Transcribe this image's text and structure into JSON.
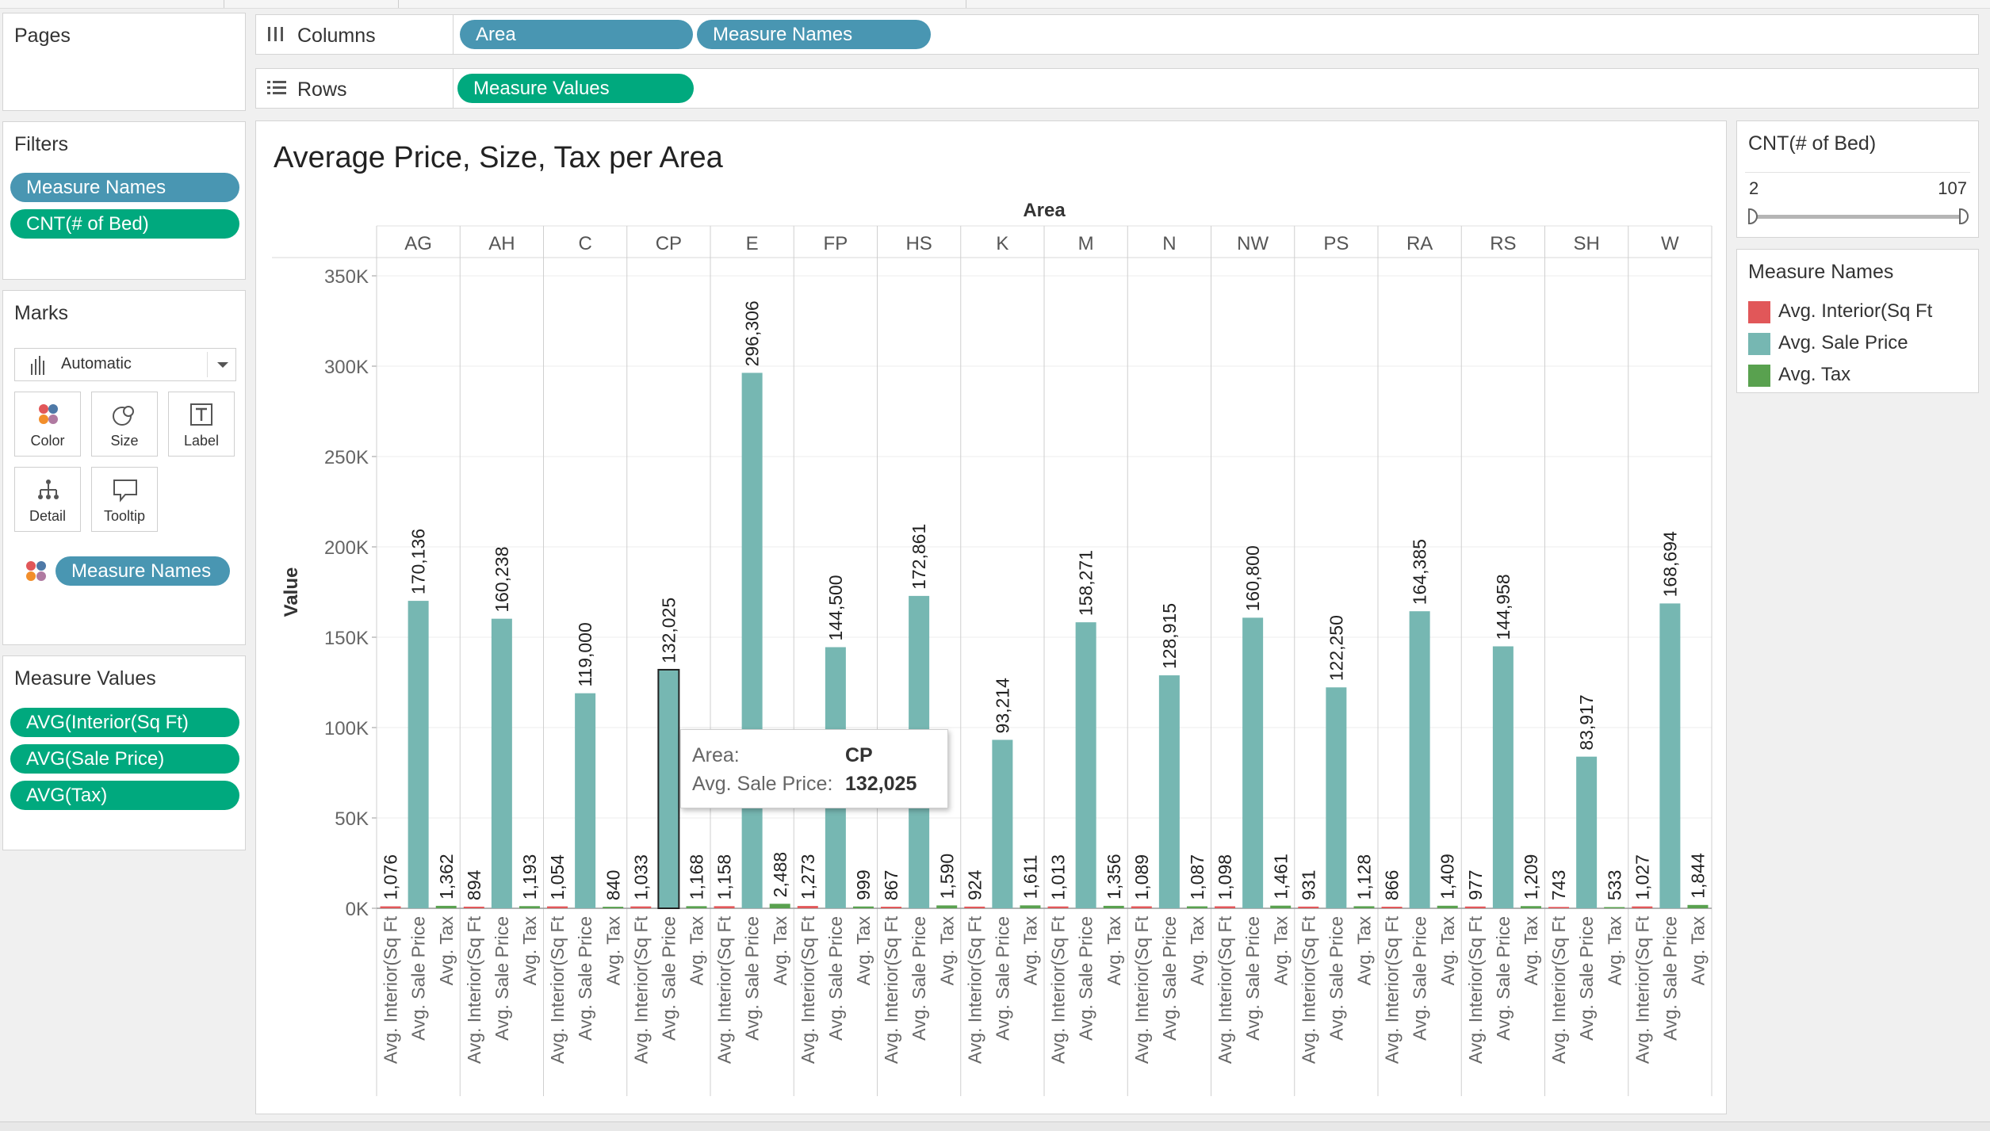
{
  "top_tabs": [],
  "pages_panel": {
    "title": "Pages"
  },
  "filters_panel": {
    "title": "Filters",
    "pills": [
      "Measure Names",
      "CNT(# of Bed)"
    ]
  },
  "marks_panel": {
    "title": "Marks",
    "mark_type": "Automatic",
    "cards": [
      {
        "label": "Color",
        "icon": "color-icon"
      },
      {
        "label": "Size",
        "icon": "size-icon"
      },
      {
        "label": "Label",
        "icon": "label-icon"
      },
      {
        "label": "Detail",
        "icon": "detail-icon"
      },
      {
        "label": "Tooltip",
        "icon": "tooltip-icon"
      }
    ],
    "color_pill": "Measure Names"
  },
  "measure_values_panel": {
    "title": "Measure Values",
    "pills": [
      "AVG(Interior(Sq Ft)",
      "AVG(Sale Price)",
      "AVG(Tax)"
    ]
  },
  "shelves": {
    "columns": {
      "title": "Columns",
      "pills": [
        "Area",
        "Measure Names"
      ]
    },
    "rows": {
      "title": "Rows",
      "pills": [
        "Measure Values"
      ]
    }
  },
  "cnt_filter": {
    "title": "CNT(# of Bed)",
    "min": "2",
    "max": "107"
  },
  "legend": {
    "title": "Measure Names",
    "items": [
      {
        "label": "Avg. Interior(Sq Ft",
        "color": "#e15759"
      },
      {
        "label": "Avg. Sale Price",
        "color": "#76b7b2"
      },
      {
        "label": "Avg. Tax",
        "color": "#59a14f"
      }
    ]
  },
  "tooltip": {
    "area_label": "Area:",
    "area_value": "CP",
    "price_label": "Avg. Sale Price:",
    "price_value": "132,025"
  },
  "chart_data": {
    "type": "bar",
    "title": "Average Price, Size, Tax per Area",
    "column_header": "Area",
    "ylabel": "Value",
    "ylim": [
      0,
      350000
    ],
    "yticks": [
      0,
      50000,
      100000,
      150000,
      200000,
      250000,
      300000,
      350000
    ],
    "ytick_labels": [
      "0K",
      "50K",
      "100K",
      "150K",
      "200K",
      "250K",
      "300K",
      "350K"
    ],
    "categories": [
      "AG",
      "AH",
      "C",
      "CP",
      "E",
      "FP",
      "HS",
      "K",
      "M",
      "N",
      "NW",
      "PS",
      "RA",
      "RS",
      "SH",
      "W"
    ],
    "measures": [
      "Avg. Interior(Sq Ft",
      "Avg. Sale Price",
      "Avg. Tax"
    ],
    "series": [
      {
        "name": "Avg. Interior(Sq Ft",
        "color": "#e15759",
        "values": [
          1076,
          894,
          1054,
          1033,
          1158,
          1273,
          867,
          924,
          1013,
          1089,
          1098,
          931,
          866,
          977,
          743,
          1027
        ],
        "labels": [
          "1,076",
          "894",
          "1,054",
          "1,033",
          "1,158",
          "1,273",
          "867",
          "924",
          "1,013",
          "1,089",
          "1,098",
          "931",
          "866",
          "977",
          "743",
          "1,027"
        ]
      },
      {
        "name": "Avg. Sale Price",
        "color": "#76b7b2",
        "values": [
          170136,
          160238,
          119000,
          132025,
          296306,
          144500,
          172861,
          93214,
          158271,
          128915,
          160800,
          122250,
          164385,
          144958,
          83917,
          168694
        ],
        "labels": [
          "170,136",
          "160,238",
          "119,000",
          "132,025",
          "296,306",
          "144,500",
          "172,861",
          "93,214",
          "158,271",
          "128,915",
          "160,800",
          "122,250",
          "164,385",
          "144,958",
          "83,917",
          "168,694"
        ]
      },
      {
        "name": "Avg. Tax",
        "color": "#59a14f",
        "values": [
          1362,
          1193,
          840,
          1168,
          2488,
          999,
          1590,
          1611,
          1356,
          1087,
          1461,
          1128,
          1409,
          1209,
          533,
          1844
        ],
        "labels": [
          "1,362",
          "1,193",
          "840",
          "1,168",
          "2,488",
          "999",
          "1,590",
          "1,611",
          "1,356",
          "1,087",
          "1,461",
          "1,128",
          "1,409",
          "1,209",
          "533",
          "1,844"
        ]
      }
    ],
    "highlighted": {
      "category": "CP",
      "measure": "Avg. Sale Price"
    },
    "grid": true,
    "legend_position": "right"
  }
}
